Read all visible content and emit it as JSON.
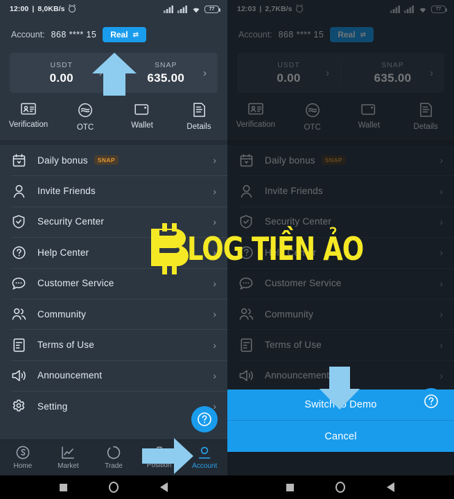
{
  "colors": {
    "bg": "#2c3641",
    "card": "#36404c",
    "accent": "#1a9ced",
    "arrow": "#8ecdf0",
    "watermark": "#f5e925",
    "snap_badge_text": "#e2962f"
  },
  "left_phone": {
    "statusbar": {
      "time": "12:00",
      "net_speed": "8,0KB/s",
      "battery": "77",
      "alarm_icon": "alarm-icon",
      "wifi_icon": "wifi-icon"
    },
    "account": {
      "label": "Account:",
      "number": "868 **** 15",
      "mode_badge": "Real",
      "mode_badge_icon": "swap-icon"
    },
    "balances": [
      {
        "currency": "USDT",
        "value": "0.00"
      },
      {
        "currency": "SNAP",
        "value": "635.00"
      }
    ],
    "quick_actions": [
      {
        "label": "Verification",
        "icon": "id-card-icon"
      },
      {
        "label": "OTC",
        "icon": "otc-exchange-icon"
      },
      {
        "label": "Wallet",
        "icon": "wallet-icon"
      },
      {
        "label": "Details",
        "icon": "document-icon"
      }
    ],
    "menu": [
      {
        "label": "Daily bonus",
        "icon": "calendar-icon",
        "badge": "SNAP"
      },
      {
        "label": "Invite Friends",
        "icon": "person-icon",
        "badge": ""
      },
      {
        "label": "Security Center",
        "icon": "shield-check-icon",
        "badge": ""
      },
      {
        "label": "Help Center",
        "icon": "question-circle-icon",
        "badge": ""
      },
      {
        "label": "Customer Service",
        "icon": "chat-bubble-icon",
        "badge": ""
      },
      {
        "label": "Community",
        "icon": "people-icon",
        "badge": ""
      },
      {
        "label": "Terms of Use",
        "icon": "document-list-icon",
        "badge": ""
      },
      {
        "label": "Announcement",
        "icon": "megaphone-icon",
        "badge": ""
      },
      {
        "label": "Setting",
        "icon": "gear-icon",
        "badge": ""
      }
    ],
    "bottom_nav": [
      {
        "label": "Home",
        "icon": "home-s-icon",
        "active": false
      },
      {
        "label": "Market",
        "icon": "chart-icon",
        "active": false
      },
      {
        "label": "Trade",
        "icon": "refresh-circle-icon",
        "active": false
      },
      {
        "label": "Position",
        "icon": "briefcase-icon",
        "active": false
      },
      {
        "label": "Account",
        "icon": "account-person-icon",
        "active": true
      }
    ],
    "fab": {
      "icon": "help-question-icon"
    }
  },
  "right_phone": {
    "statusbar": {
      "time": "12:03",
      "net_speed": "2,7KB/s",
      "battery": "77",
      "alarm_icon": "alarm-icon",
      "wifi_icon": "wifi-icon"
    },
    "account": {
      "label": "Account:",
      "number": "868 **** 15",
      "mode_badge": "Real",
      "mode_badge_icon": "swap-icon"
    },
    "balances": [
      {
        "currency": "USDT",
        "value": "0.00"
      },
      {
        "currency": "SNAP",
        "value": "635.00"
      }
    ],
    "quick_actions": [
      {
        "label": "Verification",
        "icon": "id-card-icon"
      },
      {
        "label": "OTC",
        "icon": "otc-exchange-icon"
      },
      {
        "label": "Wallet",
        "icon": "wallet-icon"
      },
      {
        "label": "Details",
        "icon": "document-icon"
      }
    ],
    "menu": [
      {
        "label": "Daily bonus",
        "icon": "calendar-icon",
        "badge": "SNAP"
      },
      {
        "label": "Invite Friends",
        "icon": "person-icon",
        "badge": ""
      },
      {
        "label": "Security Center",
        "icon": "shield-check-icon",
        "badge": ""
      },
      {
        "label": "Help Center",
        "icon": "question-circle-icon",
        "badge": ""
      },
      {
        "label": "Customer Service",
        "icon": "chat-bubble-icon",
        "badge": ""
      },
      {
        "label": "Community",
        "icon": "people-icon",
        "badge": ""
      },
      {
        "label": "Terms of Use",
        "icon": "document-list-icon",
        "badge": ""
      },
      {
        "label": "Announcement",
        "icon": "megaphone-icon",
        "badge": ""
      }
    ],
    "action_sheet": {
      "primary": "Switch to Demo",
      "cancel": "Cancel"
    },
    "fab": {
      "icon": "help-question-icon"
    }
  },
  "annotations": {
    "arrow_up": "up-arrow-annotation",
    "arrow_right": "right-arrow-annotation",
    "arrow_down": "down-arrow-annotation"
  },
  "watermark": {
    "symbol": "bitcoin-b-icon",
    "text": "LOG TIỀN ẢO"
  },
  "android_nav": {
    "recents": "recents-square-icon",
    "home": "home-circle-icon",
    "back": "back-triangle-icon"
  }
}
